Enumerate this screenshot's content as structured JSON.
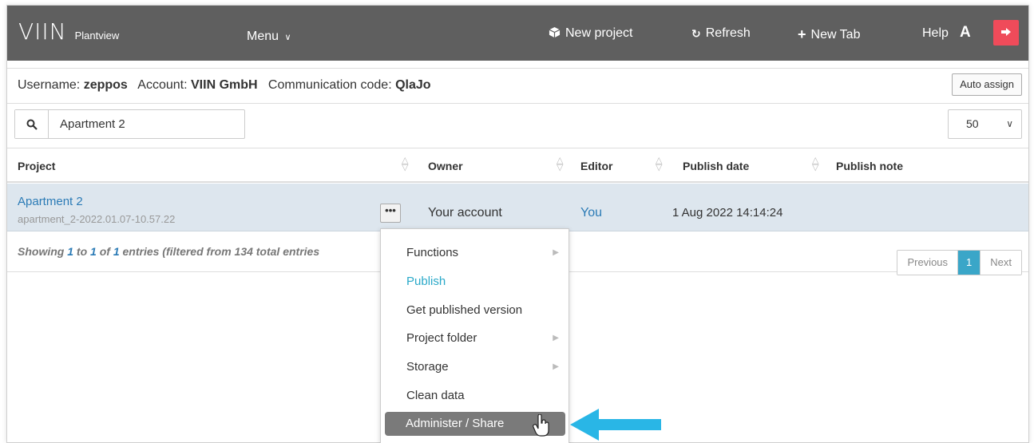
{
  "header": {
    "logo": "VIIN",
    "subtitle": "Plantview",
    "menu_label": "Menu",
    "new_project": "New project",
    "refresh": "Refresh",
    "new_tab": "New Tab",
    "help": "Help",
    "user_initial": "A",
    "logout_color": "#ef4b5a"
  },
  "info": {
    "username_label": "Username:",
    "username": "zeppos",
    "account_label": "Account:",
    "account": "VIIN GmbH",
    "comm_label": "Communication code:",
    "comm_code": "QlaJo",
    "auto_assign": "Auto assign"
  },
  "search": {
    "value": "Apartment 2",
    "page_size": "50"
  },
  "table": {
    "columns": [
      "Project",
      "Owner",
      "Editor",
      "Publish date",
      "Publish note"
    ],
    "rows": [
      {
        "project": "Apartment 2",
        "project_id": "apartment_2-2022.01.07-10.57.22",
        "actions": "•••",
        "owner": "Your account",
        "editor": "You",
        "publish_date": "1 Aug 2022 14:14:24",
        "publish_note": ""
      }
    ]
  },
  "footer": {
    "showing_pre": "Showing ",
    "from": "1",
    "to_word": " to ",
    "to": "1",
    "of_word": " of ",
    "total": "1",
    "suffix": " entries (filtered from 134 total entries",
    "prev": "Previous",
    "page": "1",
    "next": "Next"
  },
  "context_menu": {
    "items": [
      {
        "label": "Functions",
        "submenu": true
      },
      {
        "label": "Publish",
        "submenu": false
      },
      {
        "label": "Get published version",
        "submenu": false
      },
      {
        "label": "Project folder",
        "submenu": true
      },
      {
        "label": "Storage",
        "submenu": true
      },
      {
        "label": "Clean data",
        "submenu": false
      },
      {
        "label": "Administer / Share",
        "submenu": false
      }
    ]
  },
  "colors": {
    "topbar": "#5f5f5f",
    "link": "#2b7bb6",
    "accent": "#2aa9c9",
    "row_selected": "#dde6ee",
    "arrow": "#29b6e6"
  }
}
